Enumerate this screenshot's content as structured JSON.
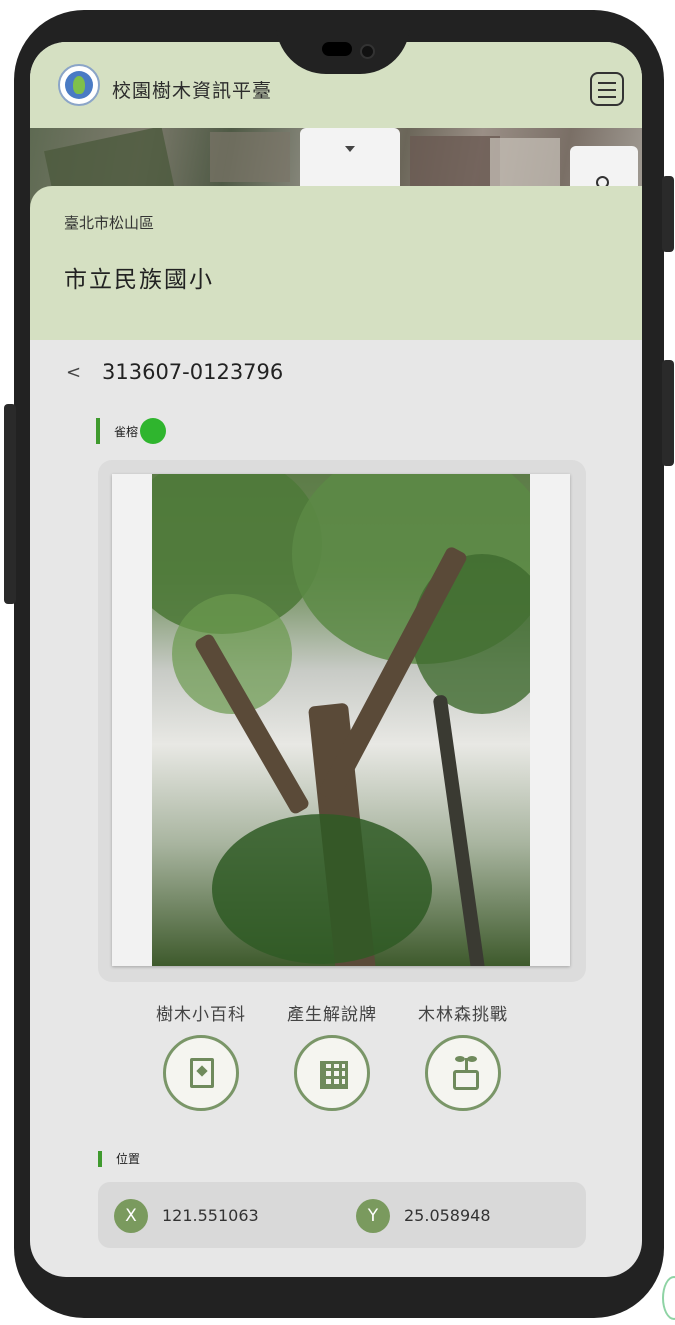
{
  "header": {
    "app_title": "校園樹木資訊平臺",
    "menu_icon": "hamburger-menu-icon"
  },
  "map": {
    "search_icon": "search-icon",
    "dropdown_icon": "caret-down-icon"
  },
  "location": {
    "district": "臺北市松山區",
    "school": "市立民族國小"
  },
  "tree": {
    "id": "313607-0123796",
    "species": "雀榕",
    "health_color": "#2fb52e"
  },
  "actions": [
    {
      "label": "樹木小百科",
      "icon": "book-icon"
    },
    {
      "label": "產生解說牌",
      "icon": "qr-code-icon"
    },
    {
      "label": "木林森挑戰",
      "icon": "sprout-icon"
    }
  ],
  "position": {
    "label": "位置",
    "x_badge": "X",
    "x_value": "121.551063",
    "y_badge": "Y",
    "y_value": "25.058948"
  },
  "colors": {
    "header_bg": "#d5e0c2",
    "accent_green": "#3f9a2e",
    "badge_green": "#7a9a5e"
  }
}
